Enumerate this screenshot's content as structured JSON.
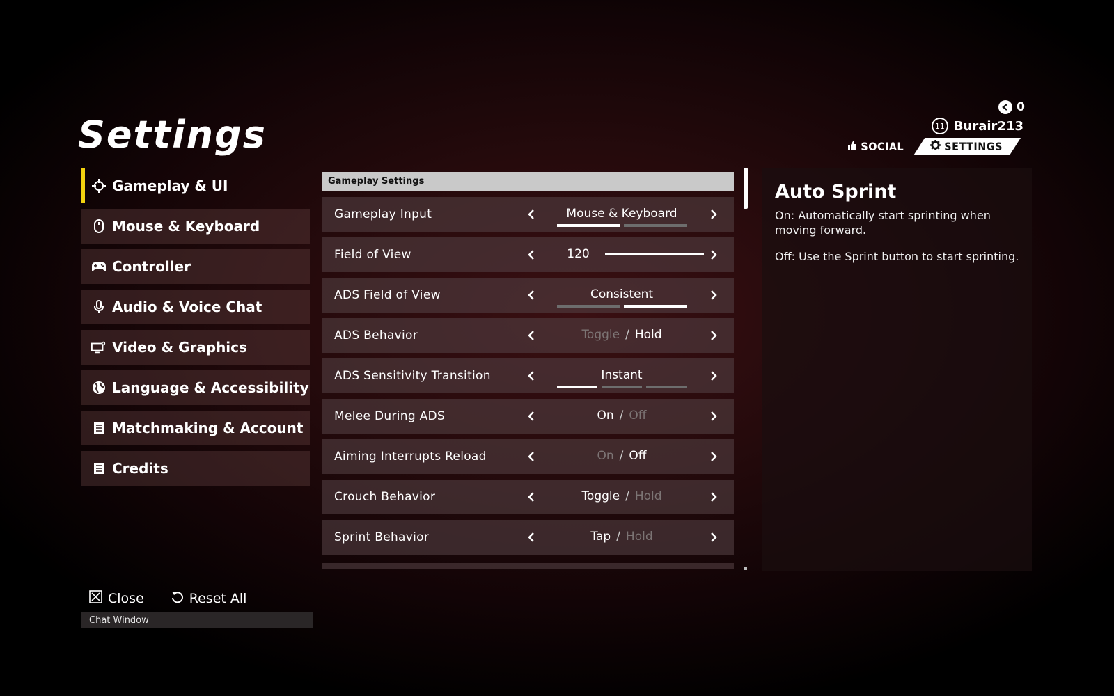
{
  "page": {
    "title": "Settings"
  },
  "header": {
    "currency_value": "0",
    "player_level": "11",
    "player_name": "Burair213",
    "tabs": [
      {
        "label": "SOCIAL"
      },
      {
        "label": "SETTINGS"
      }
    ]
  },
  "sidebar": {
    "items": [
      {
        "label": "Gameplay & UI",
        "icon": "crosshair-icon",
        "active": true
      },
      {
        "label": "Mouse & Keyboard",
        "icon": "mouse-icon"
      },
      {
        "label": "Controller",
        "icon": "gamepad-icon"
      },
      {
        "label": "Audio & Voice Chat",
        "icon": "microphone-icon"
      },
      {
        "label": "Video & Graphics",
        "icon": "monitor-gear-icon"
      },
      {
        "label": "Language & Accessibility",
        "icon": "globe-icon"
      },
      {
        "label": "Matchmaking & Account",
        "icon": "document-icon"
      },
      {
        "label": "Credits",
        "icon": "document-icon"
      }
    ]
  },
  "footer": {
    "close_label": "Close",
    "reset_label": "Reset All",
    "chat_label": "Chat Window"
  },
  "panel": {
    "header": "Gameplay Settings",
    "settings": [
      {
        "label": "Gameplay Input",
        "type": "select",
        "value": "Mouse & Keyboard",
        "segments": 2,
        "selected_index": 0
      },
      {
        "label": "Field of View",
        "type": "slider",
        "value": "120",
        "fill_fraction": 1.0
      },
      {
        "label": "ADS Field of View",
        "type": "select",
        "value": "Consistent",
        "segments": 2,
        "selected_index": 1
      },
      {
        "label": "ADS Behavior",
        "type": "toggle",
        "options": [
          "Toggle",
          "Hold"
        ],
        "selected_index": 1
      },
      {
        "label": "ADS Sensitivity Transition",
        "type": "select",
        "value": "Instant",
        "segments": 3,
        "selected_index": 0
      },
      {
        "label": "Melee During ADS",
        "type": "toggle",
        "options": [
          "On",
          "Off"
        ],
        "selected_index": 0
      },
      {
        "label": "Aiming Interrupts Reload",
        "type": "toggle",
        "options": [
          "On",
          "Off"
        ],
        "selected_index": 1
      },
      {
        "label": "Crouch Behavior",
        "type": "toggle",
        "options": [
          "Toggle",
          "Hold"
        ],
        "selected_index": 0
      },
      {
        "label": "Sprint Behavior",
        "type": "toggle",
        "options": [
          "Tap",
          "Hold"
        ],
        "selected_index": 0
      }
    ],
    "toggle_separator": "/"
  },
  "description": {
    "title": "Auto Sprint",
    "paragraphs": [
      "On: Automatically start sprinting when moving forward.",
      "Off: Use the Sprint button to start sprinting."
    ]
  },
  "colors": {
    "accent": "#f2d20f",
    "row_bg": "#503e40",
    "inactive_option": "#7c7474"
  }
}
